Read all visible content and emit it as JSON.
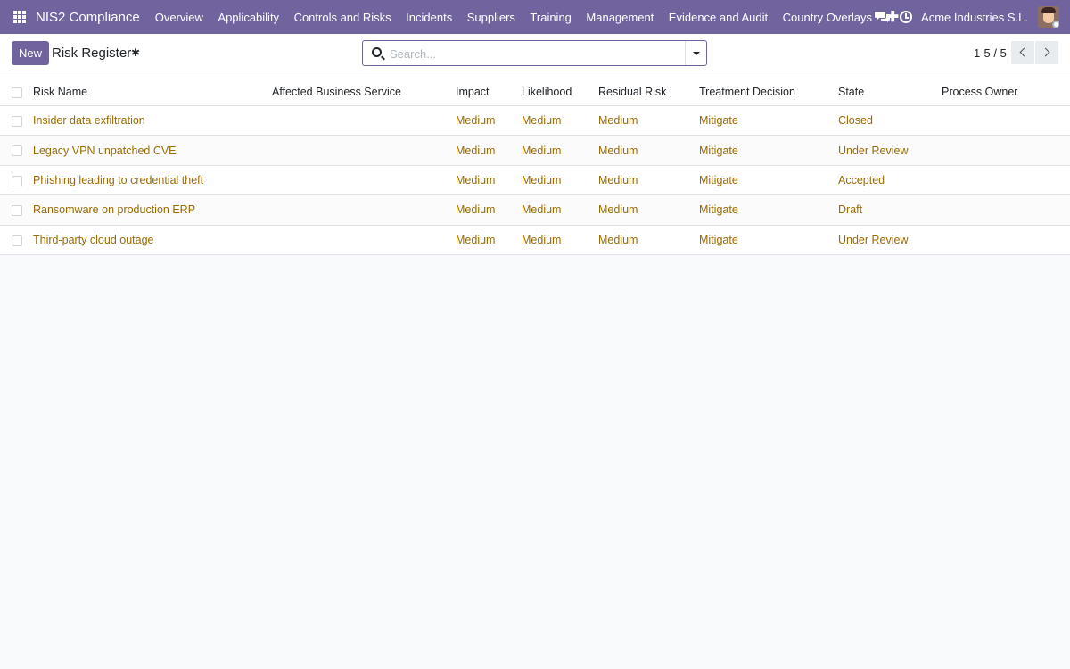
{
  "navbar": {
    "brand": "NIS2 Compliance",
    "menu": [
      "Overview",
      "Applicability",
      "Controls and Risks",
      "Incidents",
      "Suppliers",
      "Training",
      "Management",
      "Evidence and Audit",
      "Country Overlays"
    ],
    "company": "Acme Industries S.L."
  },
  "control_panel": {
    "new_label": "New",
    "title": "Risk Register",
    "search_placeholder": "Search...",
    "pager": "1-5 / 5"
  },
  "table": {
    "columns": [
      "Risk Name",
      "Affected Business Service",
      "Impact",
      "Likelihood",
      "Residual Risk",
      "Treatment Decision",
      "State",
      "Process Owner"
    ],
    "rows": [
      {
        "name": "Insider data exfiltration",
        "service": "",
        "impact": "Medium",
        "likelihood": "Medium",
        "residual": "Medium",
        "treatment": "Mitigate",
        "state": "Closed",
        "owner": ""
      },
      {
        "name": "Legacy VPN unpatched CVE",
        "service": "",
        "impact": "Medium",
        "likelihood": "Medium",
        "residual": "Medium",
        "treatment": "Mitigate",
        "state": "Under Review",
        "owner": ""
      },
      {
        "name": "Phishing leading to credential theft",
        "service": "",
        "impact": "Medium",
        "likelihood": "Medium",
        "residual": "Medium",
        "treatment": "Mitigate",
        "state": "Accepted",
        "owner": ""
      },
      {
        "name": "Ransomware on production ERP",
        "service": "",
        "impact": "Medium",
        "likelihood": "Medium",
        "residual": "Medium",
        "treatment": "Mitigate",
        "state": "Draft",
        "owner": ""
      },
      {
        "name": "Third-party cloud outage",
        "service": "",
        "impact": "Medium",
        "likelihood": "Medium",
        "residual": "Medium",
        "treatment": "Mitigate",
        "state": "Under Review",
        "owner": ""
      }
    ]
  }
}
